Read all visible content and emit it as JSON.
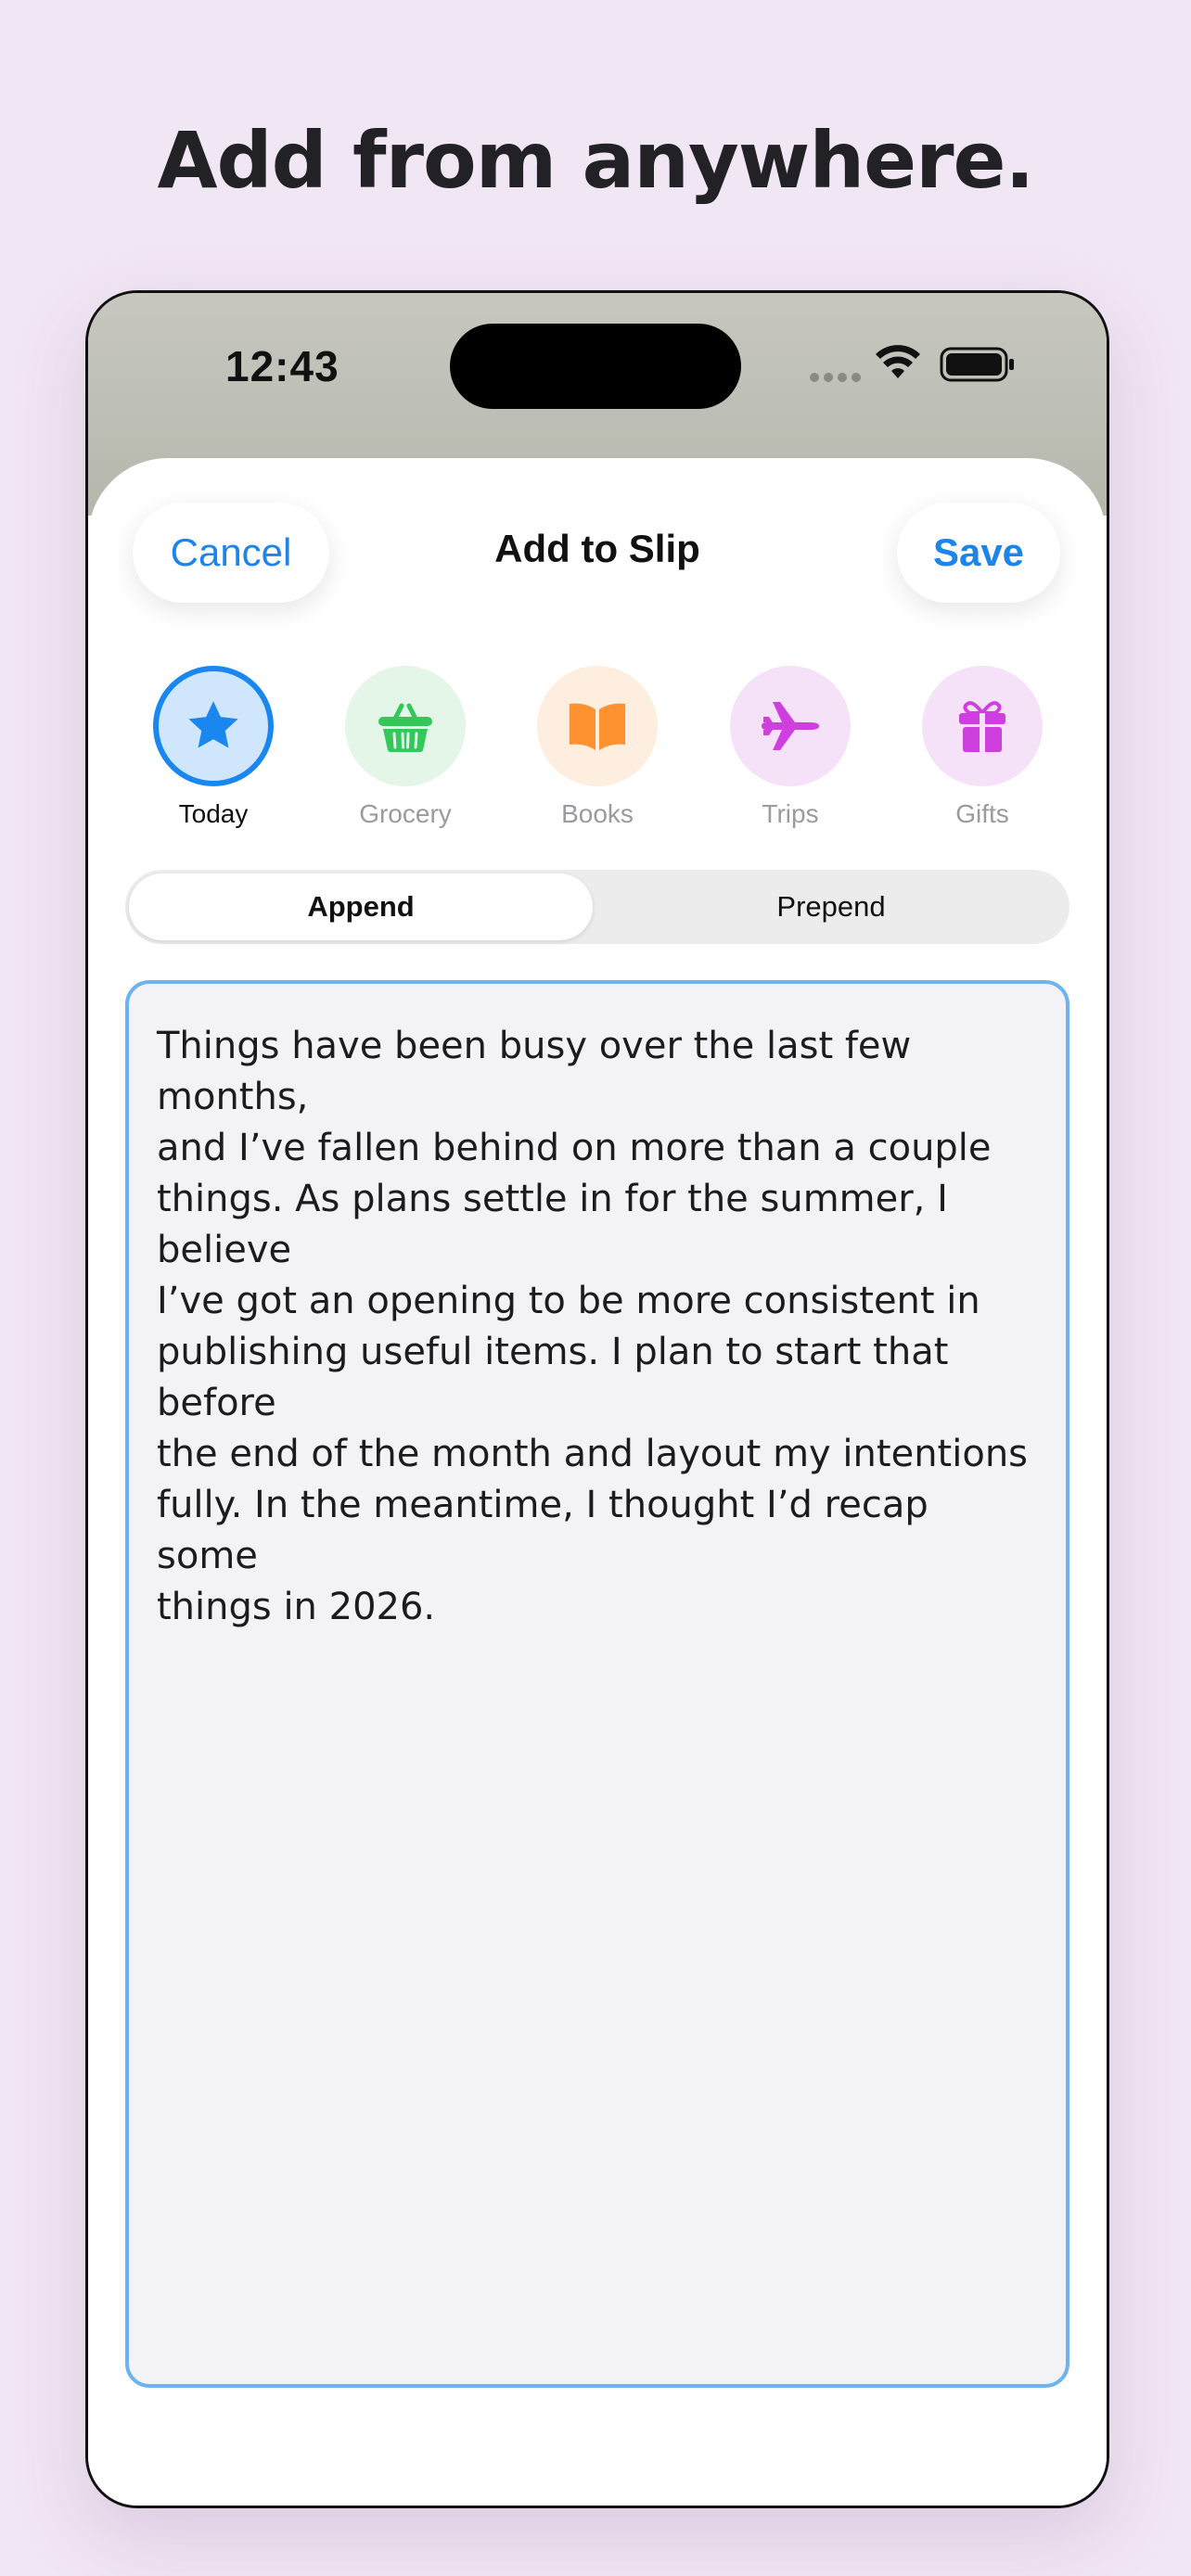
{
  "headline": "Add from anywhere.",
  "status_bar": {
    "time": "12:43",
    "signal_icon": "cellular-dots-icon",
    "wifi_icon": "wifi-icon",
    "battery_icon": "battery-full-icon"
  },
  "sheet": {
    "title": "Add to Slip",
    "cancel_label": "Cancel",
    "save_label": "Save"
  },
  "categories": [
    {
      "label": "Today",
      "icon": "star-icon",
      "color": "#1a87f0",
      "bg": "#cfe6fc",
      "selected": true
    },
    {
      "label": "Grocery",
      "icon": "basket-icon",
      "color": "#34c759",
      "bg": "#e3f6e7",
      "selected": false
    },
    {
      "label": "Books",
      "icon": "book-icon",
      "color": "#ff9230",
      "bg": "#fdeee0",
      "selected": false
    },
    {
      "label": "Trips",
      "icon": "airplane-icon",
      "color": "#cf3fe0",
      "bg": "#f6e2f8",
      "selected": false
    },
    {
      "label": "Gifts",
      "icon": "gift-icon",
      "color": "#cf3fe0",
      "bg": "#f6e2f8",
      "selected": false
    }
  ],
  "mode": {
    "append_label": "Append",
    "prepend_label": "Prepend",
    "selected": "Append"
  },
  "editor": {
    "lines": [
      "Things have been busy over the last few months,",
      "and I’ve fallen behind on more than a couple",
      "things. As plans settle in for the summer, I believe",
      "I’ve got an opening to be more consistent in",
      "publishing useful items. I plan to start that before",
      "the end of the month and layout my intentions",
      "fully. In the meantime, I thought I’d recap some",
      "things in 2026."
    ]
  },
  "colors": {
    "accent": "#1a87f0",
    "background": "#f1e6f4",
    "editor_border": "#6cb3ef",
    "editor_fill": "#f2f2f7"
  }
}
